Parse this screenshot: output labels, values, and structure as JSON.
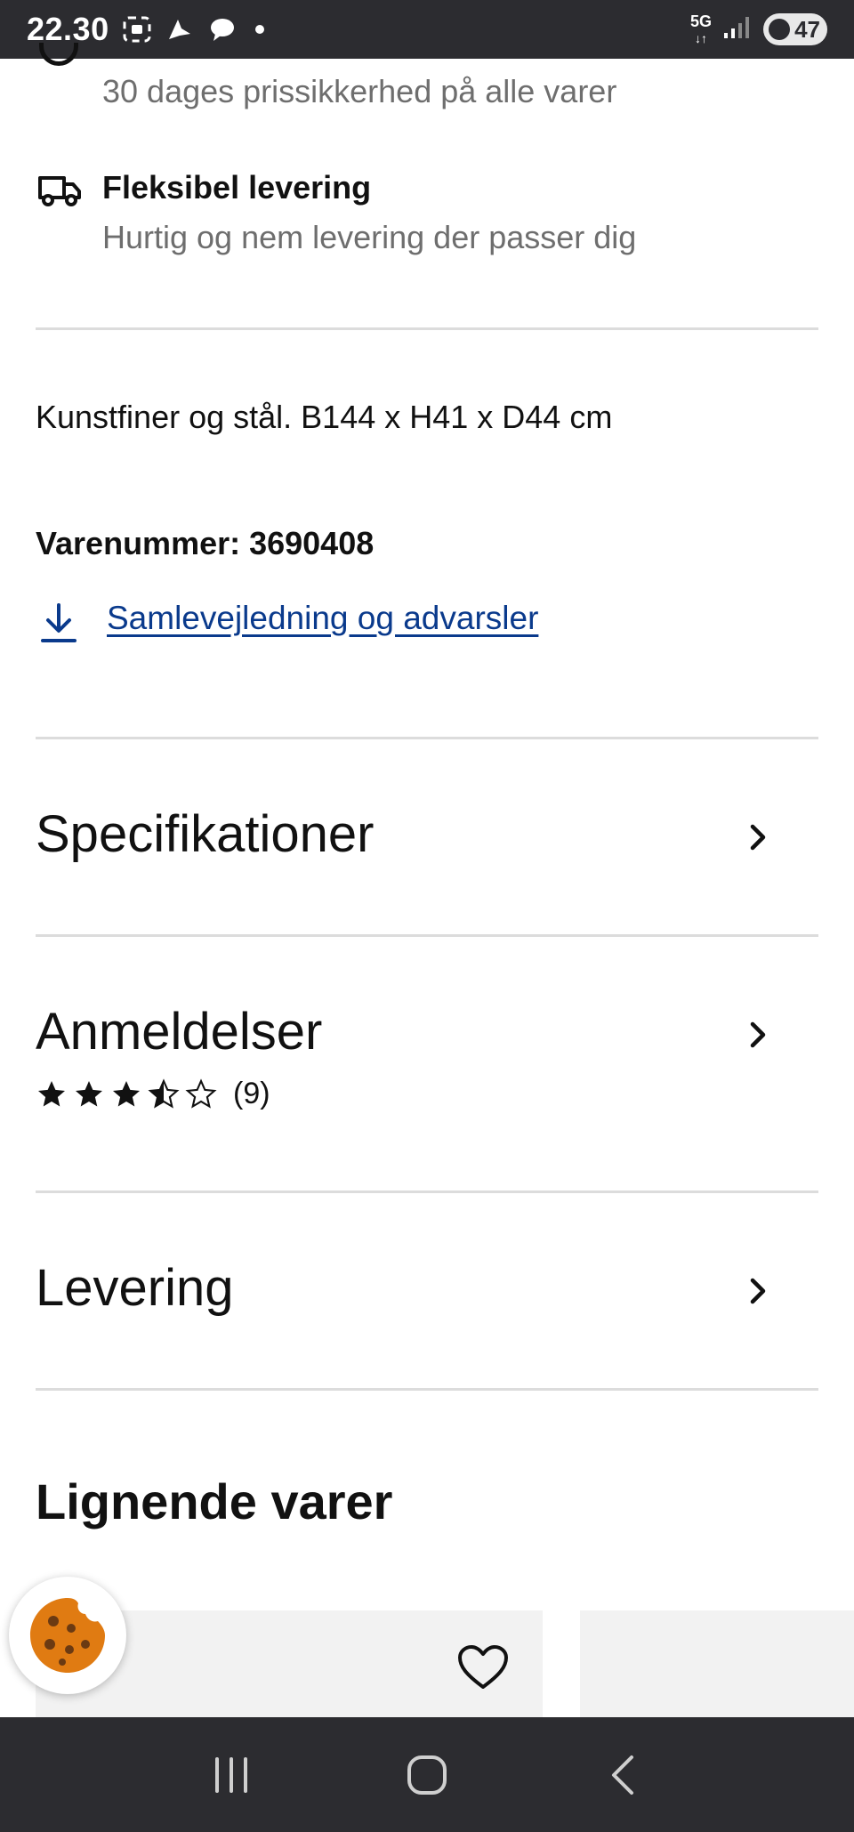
{
  "status_bar": {
    "time": "22.30",
    "network": "5G",
    "battery": "47"
  },
  "benefits": [
    {
      "title": "",
      "subtitle": "30 dages prissikkerhed på alle varer",
      "icon": "price-tag-icon"
    },
    {
      "title": "Fleksibel levering",
      "subtitle": "Hurtig og nem levering der passer dig",
      "icon": "truck-icon"
    }
  ],
  "product": {
    "description": "Kunstfiner og stål. B144 x H41 x D44 cm",
    "article_number_label": "Varenummer: 3690408",
    "download_link": "Samlevejledning og advarsler"
  },
  "sections": {
    "specifications": "Specifikationer",
    "reviews": "Anmeldelser",
    "review_count": "(9)",
    "rating": 3.5,
    "rating_max": 5,
    "delivery": "Levering"
  },
  "similar": {
    "heading": "Lignende varer"
  },
  "colors": {
    "link": "#0a3a8c",
    "status_bar": "#2c2c30",
    "cookie": "#e07b12"
  }
}
